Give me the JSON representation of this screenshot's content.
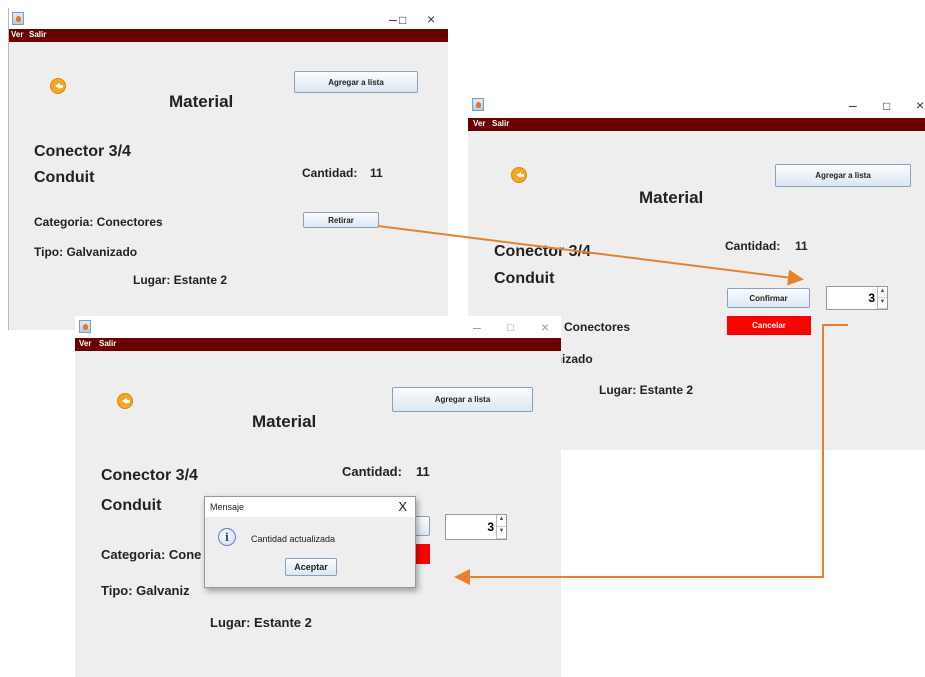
{
  "window": {
    "minimize_glyph": "–",
    "maximize_glyph": "□",
    "close_glyph": "×",
    "menu": [
      "Ver",
      "Salir"
    ]
  },
  "panel": {
    "add_to_list": "Agregar a lista",
    "title": "Material",
    "name_line1": "Conector 3/4",
    "name_line2": "Conduit",
    "quantity_label": "Cantidad:",
    "quantity_value": "11",
    "category": "Categoria: Conectores",
    "category_partial_bottom": "Categoria: Cone",
    "category_partial_right": "Conectores",
    "type": "Tipo: Galvanizado",
    "type_partial_right": "anizado",
    "type_partial_bottom": "Tipo: Galvaniz",
    "location": "Lugar: Estante 2",
    "withdraw_button": "Retirar",
    "confirm_button": "Confirmar",
    "cancel_button": "Cancelar",
    "spinner_value": "3",
    "spinner_up": "▲",
    "spinner_down": "▼"
  },
  "dialog": {
    "title": "Mensaje",
    "close_glyph": "X",
    "message": "Cantidad actualizada",
    "ok_button": "Aceptar",
    "icon_glyph": "i"
  },
  "colors": {
    "menubar": "#6b0000",
    "cancel": "#ff0000",
    "arrow": "#e8812e",
    "back_button": "#f5a623"
  }
}
